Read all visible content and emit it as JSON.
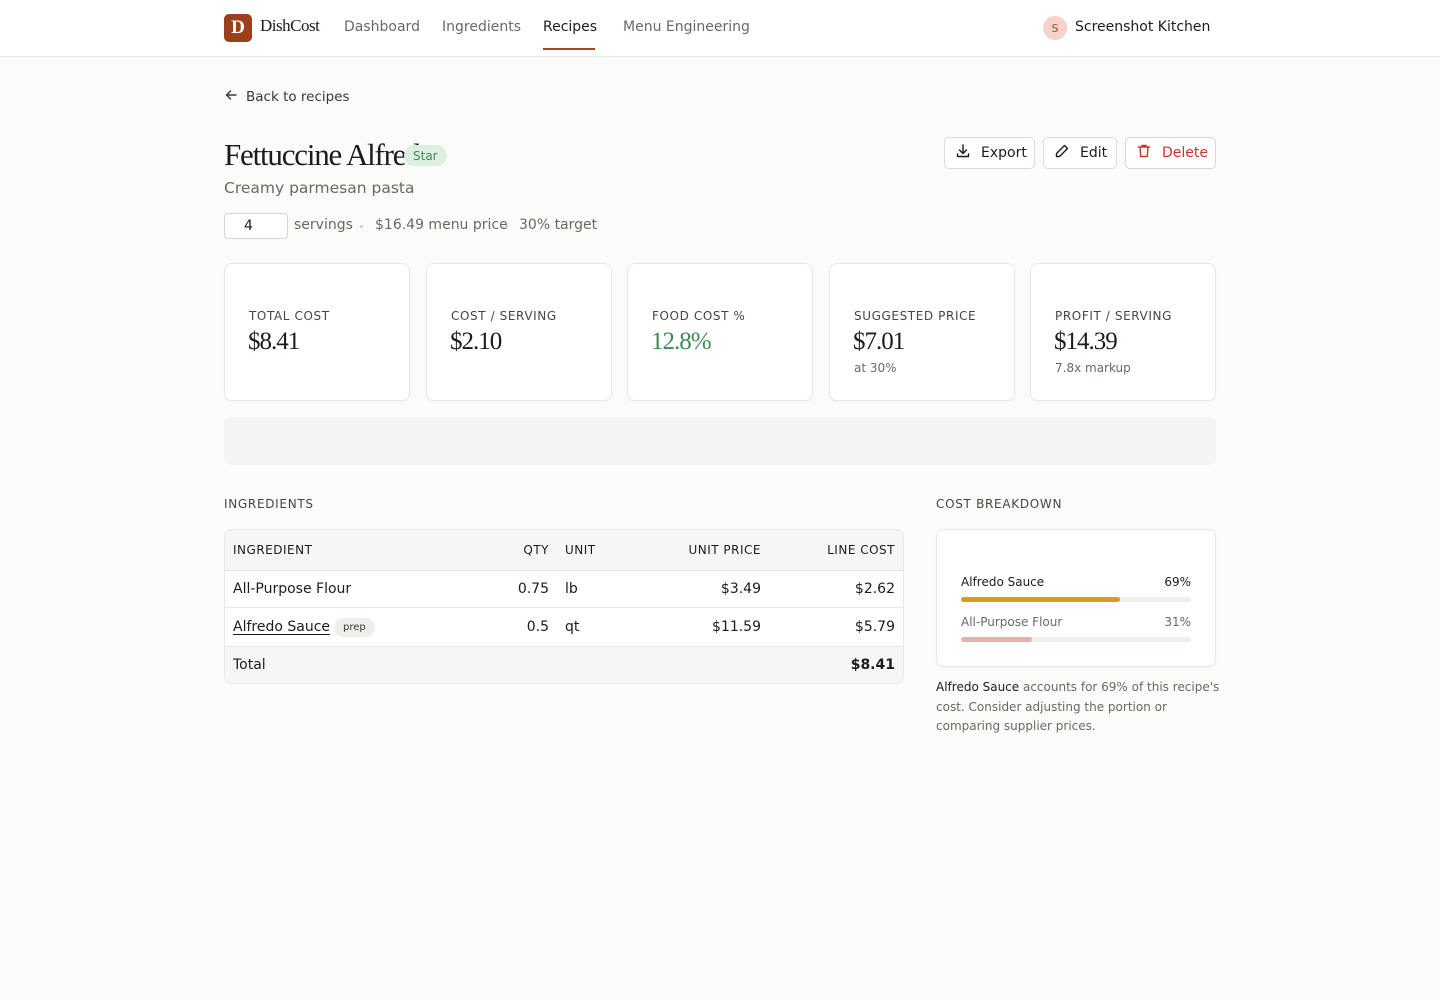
{
  "app": {
    "logo_letter": "D",
    "name": "DishCost"
  },
  "nav": {
    "items": [
      {
        "label": "Dashboard",
        "active": false
      },
      {
        "label": "Ingredients",
        "active": false
      },
      {
        "label": "Recipes",
        "active": true
      },
      {
        "label": "Menu Engineering",
        "active": false
      }
    ],
    "user_initial": "S",
    "kitchen": "Screenshot Kitchen"
  },
  "back_link": "Back to recipes",
  "recipe": {
    "title": "Fettuccine Alfredo",
    "badge": "Star",
    "description": "Creamy parmesan pasta",
    "servings": "4",
    "servings_label": "servings",
    "menu_price": "$16.49 menu price",
    "target": "30% target"
  },
  "actions": {
    "export": "Export",
    "edit": "Edit",
    "delete": "Delete"
  },
  "stats": [
    {
      "label": "TOTAL COST",
      "value": "$8.41",
      "sub": ""
    },
    {
      "label": "COST / SERVING",
      "value": "$2.10",
      "sub": ""
    },
    {
      "label": "FOOD COST %",
      "value": "12.8%",
      "sub": ""
    },
    {
      "label": "SUGGESTED PRICE",
      "value": "$7.01",
      "sub": "at 30%"
    },
    {
      "label": "PROFIT / SERVING",
      "value": "$14.39",
      "sub": "7.8x markup"
    }
  ],
  "ingredients": {
    "heading": "INGREDIENTS",
    "columns": [
      "INGREDIENT",
      "QTY",
      "UNIT",
      "UNIT PRICE",
      "LINE COST"
    ],
    "rows": [
      {
        "name": "All-Purpose Flour",
        "badge": "",
        "qty": "0.75",
        "unit": "lb",
        "unit_price": "$3.49",
        "line_cost": "$2.62"
      },
      {
        "name": "Alfredo Sauce",
        "badge": "prep",
        "qty": "0.5",
        "unit": "qt",
        "unit_price": "$11.59",
        "line_cost": "$5.79"
      }
    ],
    "total_label": "Total",
    "total_value": "$8.41"
  },
  "breakdown": {
    "heading": "COST BREAKDOWN",
    "items": [
      {
        "name": "Alfredo Sauce",
        "pct_label": "69%",
        "fraction": 0.69,
        "color": "#d4a017"
      },
      {
        "name": "All-Purpose Flour",
        "pct_label": "31%",
        "fraction": 0.31,
        "color": "#e2b3ad"
      }
    ],
    "insight_strong": "Alfredo Sauce",
    "insight_rest": " accounts for 69% of this recipe's cost. Consider adjusting the portion or comparing supplier prices."
  },
  "colors": {
    "brand": "#9c3f1f",
    "active_underline": "#a8442a",
    "success": "#3f8a55",
    "danger": "#c9352b"
  }
}
